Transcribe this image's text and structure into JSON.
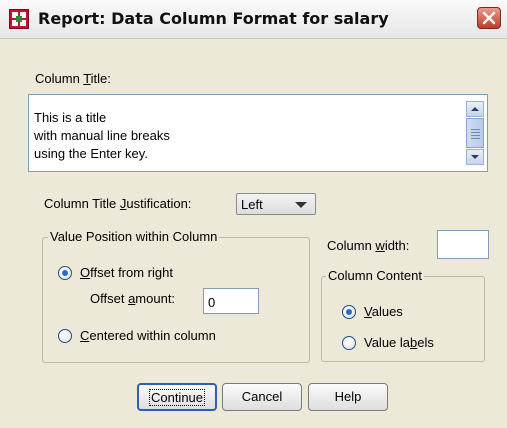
{
  "window": {
    "title": "Report: Data Column Format for salary",
    "app_icon": "spss-report-icon",
    "close_icon": "close-icon"
  },
  "column_title": {
    "label_prefix": "Column ",
    "label_underline": "T",
    "label_suffix": "itle:",
    "lines": [
      "This is a title",
      "with manual line breaks",
      "using the Enter key."
    ]
  },
  "justification": {
    "label_prefix": "Column Title ",
    "label_underline": "J",
    "label_suffix": "ustification:",
    "selected": "Left"
  },
  "value_position": {
    "legend": "Value Position within Column",
    "offset_from_right": {
      "underline": "O",
      "suffix": "ffset from right",
      "selected": true
    },
    "offset_amount": {
      "prefix": "Offset ",
      "underline": "a",
      "suffix": "mount:",
      "value": "0"
    },
    "centered": {
      "underline": "C",
      "suffix": "entered within column",
      "selected": false
    }
  },
  "column_width": {
    "label_prefix": "Column ",
    "label_underline": "w",
    "label_suffix": "idth:",
    "value": ""
  },
  "column_content": {
    "legend": "Column Content",
    "values": {
      "underline": "V",
      "suffix": "alues",
      "selected": true
    },
    "value_labels": {
      "prefix": "Value la",
      "underline": "b",
      "suffix": "els",
      "selected": false
    }
  },
  "buttons": {
    "continue": "Continue",
    "cancel": "Cancel",
    "help": "Help"
  },
  "colors": {
    "dialog_background": "#ece9d8",
    "accent": "#2a6ad8",
    "close_button": "#c0392b"
  }
}
